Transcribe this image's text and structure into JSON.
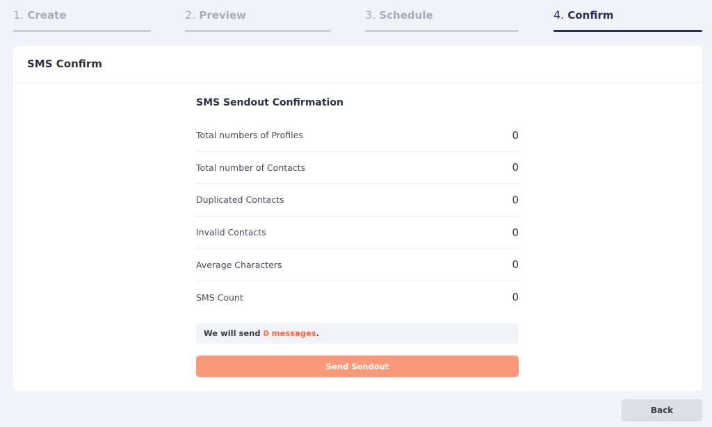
{
  "stepper": {
    "steps": [
      {
        "num": "1.",
        "label": "Create"
      },
      {
        "num": "2.",
        "label": "Preview"
      },
      {
        "num": "3.",
        "label": "Schedule"
      },
      {
        "num": "4.",
        "label": "Confirm"
      }
    ],
    "active_index": 3
  },
  "card": {
    "title": "SMS Confirm"
  },
  "confirmation": {
    "title": "SMS Sendout Confirmation",
    "rows": [
      {
        "label": "Total numbers of Profiles",
        "value": "0"
      },
      {
        "label": "Total number of Contacts",
        "value": "0"
      },
      {
        "label": "Duplicated Contacts",
        "value": "0"
      },
      {
        "label": "Invalid Contacts",
        "value": "0"
      },
      {
        "label": "Average Characters",
        "value": "0"
      },
      {
        "label": "SMS Count",
        "value": "0"
      }
    ]
  },
  "notice": {
    "prefix": "We will send ",
    "highlight": "0 messages",
    "suffix": "."
  },
  "buttons": {
    "send_label": "Send Sendout",
    "back_label": "Back"
  },
  "colors": {
    "accent": "#ff6a3d",
    "send_button": "#f99a7a",
    "active_step": "#2c2c5a"
  }
}
